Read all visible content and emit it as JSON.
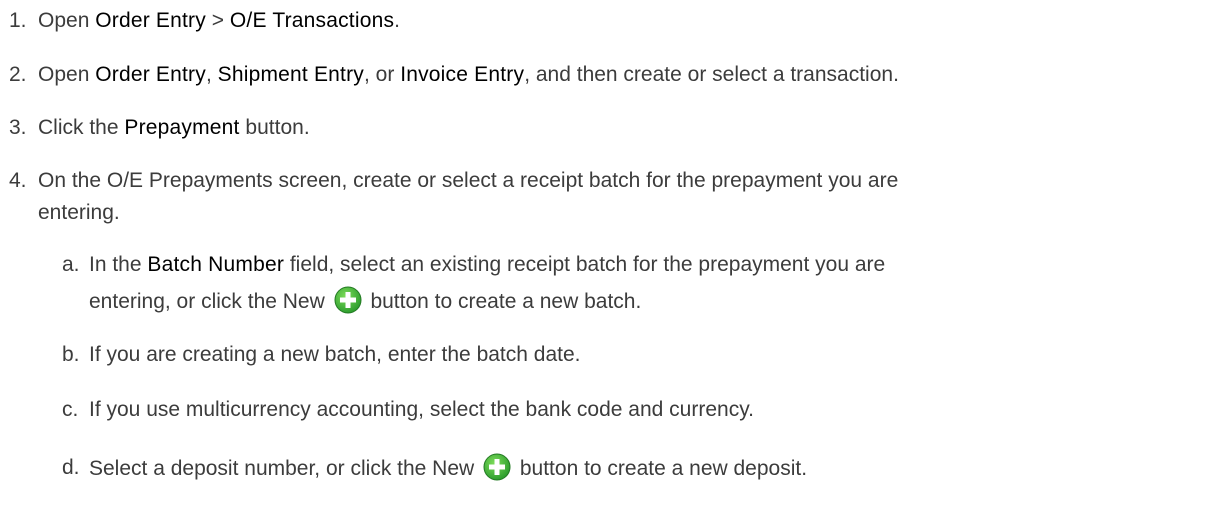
{
  "steps": [
    {
      "num": "1.",
      "pre": "Open ",
      "b1": "Order Entry",
      "mid": " > ",
      "b2": "O/E Transactions",
      "post": "."
    },
    {
      "num": "2.",
      "pre": "Open ",
      "b1": "Order Entry",
      "s1": ", ",
      "b2": "Shipment Entry",
      "s2": ", or ",
      "b3": "Invoice Entry",
      "post": ", and then create or select a transaction."
    },
    {
      "num": "3.",
      "pre": "Click the ",
      "b1": "Prepayment",
      "post": " button."
    },
    {
      "num": "4.",
      "line1": "On the O/E Prepayments screen, create or select a receipt batch for the prepayment you are",
      "line2": "entering."
    }
  ],
  "substeps": [
    {
      "num": "a.",
      "pre": "In the ",
      "b1": "Batch Number",
      "post": " field, select an existing receipt batch for the prepayment you are",
      "line2_pre": "entering, or click the New ",
      "line2_post": " button to create a new batch."
    },
    {
      "num": "b.",
      "text": "If you are creating a new batch, enter the batch date."
    },
    {
      "num": "c.",
      "text": "If you use multicurrency accounting, select the bank code and currency."
    },
    {
      "num": "d.",
      "pre": "Select a deposit number, or click the New ",
      "post": " button to create a new deposit."
    }
  ],
  "icons": {
    "new": "plus-circle-icon"
  },
  "colors": {
    "icon_green": "#3cb043",
    "text": "#3c3c3c",
    "ui_label": "#000000"
  }
}
